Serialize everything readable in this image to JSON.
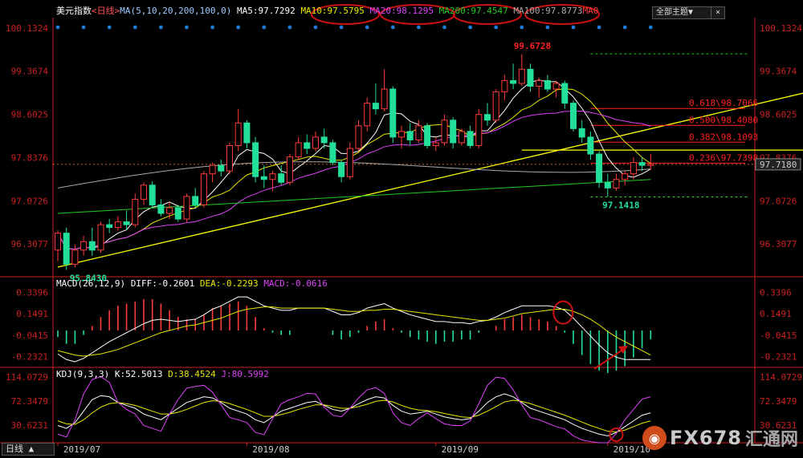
{
  "header": {
    "name": "美元指数",
    "period": "<日线>",
    "ma_label": "MA(5,10,20,200,100,0)",
    "ma5": "MA5:97.7292",
    "ma10": "MA10:97.5795",
    "ma20": "MA20:98.1295",
    "ma200": "MA200:97.4547",
    "ma100": "MA100:97.8773",
    "ma0": "MA0",
    "theme_button": "全部主题▼",
    "close_icon": "×"
  },
  "colors": {
    "up": "#ff3b3b",
    "down": "#22e09a",
    "ma5": "#ffffff",
    "ma10": "#e8e800",
    "ma20": "#e040fb",
    "ma200": "#22cc22",
    "ma100": "#aaaaaa",
    "trend": "#ffff00",
    "fib": "#ff2020",
    "axis": "#cc2020",
    "annot": "#cc1111"
  },
  "chart_data": [
    {
      "type": "candlestick",
      "title": "美元指数 <日线>",
      "ylim": [
        95.8,
        100.2
      ],
      "y_ticks": [
        "100.1324",
        "99.3674",
        "98.6025",
        "97.8376",
        "97.0726",
        "96.3077"
      ],
      "x_ticks": [
        {
          "label": "2019/07",
          "x": 0
        },
        {
          "label": "2019/08",
          "x": 22
        },
        {
          "label": "2019/09",
          "x": 44
        },
        {
          "label": "2019/10",
          "x": 64
        }
      ],
      "labels": {
        "high": "99.6728",
        "low": "95.8430",
        "low2": "97.1418",
        "last": "97.7180"
      },
      "fibonacci": [
        {
          "label": "0.618\\98.7066",
          "value": 98.7066
        },
        {
          "label": "0.500\\98.4080",
          "value": 98.408
        },
        {
          "label": "0.382\\98.1093",
          "value": 98.1093
        },
        {
          "label": "0.236\\97.7398",
          "value": 97.7398
        }
      ],
      "fib_dashed": [
        99.6728,
        97.1418
      ],
      "trendline": [
        [
          0,
          95.9
        ],
        [
          117,
          100.05
        ]
      ],
      "horizontal_line": {
        "value": 97.97,
        "x0": 54,
        "x1": 92
      },
      "dashed_last": 97.718,
      "candles": [
        {
          "o": 96.2,
          "h": 96.55,
          "l": 96.0,
          "c": 96.5
        },
        {
          "o": 96.5,
          "h": 96.6,
          "l": 95.85,
          "c": 95.95
        },
        {
          "o": 95.95,
          "h": 96.3,
          "l": 95.9,
          "c": 96.2
        },
        {
          "o": 96.2,
          "h": 96.45,
          "l": 96.1,
          "c": 96.35
        },
        {
          "o": 96.35,
          "h": 96.6,
          "l": 96.1,
          "c": 96.2
        },
        {
          "o": 96.2,
          "h": 96.7,
          "l": 96.15,
          "c": 96.65
        },
        {
          "o": 96.65,
          "h": 96.75,
          "l": 96.5,
          "c": 96.6
        },
        {
          "o": 96.6,
          "h": 96.8,
          "l": 96.55,
          "c": 96.7
        },
        {
          "o": 96.7,
          "h": 96.9,
          "l": 96.55,
          "c": 96.65
        },
        {
          "o": 96.65,
          "h": 97.2,
          "l": 96.6,
          "c": 97.1
        },
        {
          "o": 97.1,
          "h": 97.4,
          "l": 97.0,
          "c": 97.35
        },
        {
          "o": 97.35,
          "h": 97.42,
          "l": 96.95,
          "c": 97.0
        },
        {
          "o": 97.0,
          "h": 97.1,
          "l": 96.8,
          "c": 96.85
        },
        {
          "o": 96.85,
          "h": 97.05,
          "l": 96.75,
          "c": 96.95
        },
        {
          "o": 96.95,
          "h": 97.0,
          "l": 96.7,
          "c": 96.75
        },
        {
          "o": 96.75,
          "h": 97.2,
          "l": 96.7,
          "c": 97.15
        },
        {
          "o": 97.15,
          "h": 97.3,
          "l": 96.95,
          "c": 97.0
        },
        {
          "o": 97.0,
          "h": 97.6,
          "l": 96.95,
          "c": 97.55
        },
        {
          "o": 97.55,
          "h": 97.75,
          "l": 97.4,
          "c": 97.7
        },
        {
          "o": 97.7,
          "h": 97.8,
          "l": 97.5,
          "c": 97.6
        },
        {
          "o": 97.6,
          "h": 98.1,
          "l": 97.55,
          "c": 98.05
        },
        {
          "o": 98.05,
          "h": 98.7,
          "l": 97.95,
          "c": 98.45
        },
        {
          "o": 98.45,
          "h": 98.5,
          "l": 98.0,
          "c": 98.1
        },
        {
          "o": 98.1,
          "h": 98.2,
          "l": 97.4,
          "c": 97.5
        },
        {
          "o": 97.5,
          "h": 97.7,
          "l": 97.3,
          "c": 97.45
        },
        {
          "o": 97.45,
          "h": 97.6,
          "l": 97.25,
          "c": 97.55
        },
        {
          "o": 97.55,
          "h": 97.7,
          "l": 97.35,
          "c": 97.4
        },
        {
          "o": 97.4,
          "h": 97.9,
          "l": 97.35,
          "c": 97.85
        },
        {
          "o": 97.85,
          "h": 98.2,
          "l": 97.8,
          "c": 98.1
        },
        {
          "o": 98.1,
          "h": 98.25,
          "l": 97.9,
          "c": 98.0
        },
        {
          "o": 98.0,
          "h": 98.3,
          "l": 97.95,
          "c": 98.2
        },
        {
          "o": 98.2,
          "h": 98.35,
          "l": 98.0,
          "c": 98.1
        },
        {
          "o": 98.1,
          "h": 98.15,
          "l": 97.7,
          "c": 97.75
        },
        {
          "o": 97.75,
          "h": 97.8,
          "l": 97.4,
          "c": 97.5
        },
        {
          "o": 97.5,
          "h": 98.1,
          "l": 97.45,
          "c": 98.0
        },
        {
          "o": 98.0,
          "h": 98.5,
          "l": 97.95,
          "c": 98.4
        },
        {
          "o": 98.4,
          "h": 98.9,
          "l": 98.3,
          "c": 98.8
        },
        {
          "o": 98.8,
          "h": 99.15,
          "l": 98.6,
          "c": 98.7
        },
        {
          "o": 98.7,
          "h": 99.4,
          "l": 98.65,
          "c": 99.05
        },
        {
          "o": 99.05,
          "h": 99.1,
          "l": 98.1,
          "c": 98.2
        },
        {
          "o": 98.2,
          "h": 98.4,
          "l": 98.0,
          "c": 98.3
        },
        {
          "o": 98.3,
          "h": 98.45,
          "l": 98.05,
          "c": 98.15
        },
        {
          "o": 98.15,
          "h": 98.5,
          "l": 98.1,
          "c": 98.4
        },
        {
          "o": 98.4,
          "h": 98.45,
          "l": 98.0,
          "c": 98.05
        },
        {
          "o": 98.05,
          "h": 98.2,
          "l": 97.95,
          "c": 98.1
        },
        {
          "o": 98.1,
          "h": 98.6,
          "l": 98.05,
          "c": 98.5
        },
        {
          "o": 98.5,
          "h": 98.55,
          "l": 98.0,
          "c": 98.1
        },
        {
          "o": 98.1,
          "h": 98.35,
          "l": 98.05,
          "c": 98.3
        },
        {
          "o": 98.3,
          "h": 98.4,
          "l": 98.0,
          "c": 98.05
        },
        {
          "o": 98.05,
          "h": 98.7,
          "l": 98.0,
          "c": 98.6
        },
        {
          "o": 98.6,
          "h": 98.8,
          "l": 98.4,
          "c": 98.5
        },
        {
          "o": 98.5,
          "h": 99.05,
          "l": 98.45,
          "c": 99.0
        },
        {
          "o": 99.0,
          "h": 99.3,
          "l": 98.85,
          "c": 99.2
        },
        {
          "o": 99.2,
          "h": 99.5,
          "l": 99.05,
          "c": 99.15
        },
        {
          "o": 99.15,
          "h": 99.67,
          "l": 99.1,
          "c": 99.4
        },
        {
          "o": 99.4,
          "h": 99.5,
          "l": 99.0,
          "c": 99.1
        },
        {
          "o": 99.1,
          "h": 99.25,
          "l": 98.9,
          "c": 99.2
        },
        {
          "o": 99.2,
          "h": 99.3,
          "l": 99.0,
          "c": 99.05
        },
        {
          "o": 99.05,
          "h": 99.2,
          "l": 98.9,
          "c": 99.15
        },
        {
          "o": 99.15,
          "h": 99.2,
          "l": 98.7,
          "c": 98.8
        },
        {
          "o": 98.8,
          "h": 98.85,
          "l": 98.3,
          "c": 98.35
        },
        {
          "o": 98.35,
          "h": 98.5,
          "l": 98.1,
          "c": 98.2
        },
        {
          "o": 98.2,
          "h": 98.3,
          "l": 97.8,
          "c": 97.9
        },
        {
          "o": 97.9,
          "h": 97.95,
          "l": 97.3,
          "c": 97.4
        },
        {
          "o": 97.4,
          "h": 97.55,
          "l": 97.14,
          "c": 97.3
        },
        {
          "o": 97.3,
          "h": 97.55,
          "l": 97.25,
          "c": 97.45
        },
        {
          "o": 97.45,
          "h": 97.6,
          "l": 97.35,
          "c": 97.55
        },
        {
          "o": 97.55,
          "h": 97.85,
          "l": 97.45,
          "c": 97.75
        },
        {
          "o": 97.75,
          "h": 97.85,
          "l": 97.6,
          "c": 97.7
        },
        {
          "o": 97.7,
          "h": 97.9,
          "l": 97.62,
          "c": 97.72
        }
      ]
    },
    {
      "type": "bar",
      "title": "MACD(26,12,9)",
      "legend": [
        "DIFF:-0.2601",
        "DEA:-0.2293",
        "MACD:-0.0616"
      ],
      "ylim": [
        -0.33,
        0.43
      ],
      "y_ticks": [
        "0.3396",
        "0.1491",
        "-0.0415",
        "-0.2321"
      ],
      "diff": [
        -0.21,
        -0.26,
        -0.28,
        -0.25,
        -0.2,
        -0.15,
        -0.1,
        -0.06,
        -0.02,
        0.02,
        0.06,
        0.09,
        0.1,
        0.09,
        0.08,
        0.09,
        0.1,
        0.14,
        0.19,
        0.22,
        0.26,
        0.3,
        0.3,
        0.26,
        0.22,
        0.2,
        0.18,
        0.18,
        0.2,
        0.2,
        0.2,
        0.2,
        0.17,
        0.14,
        0.14,
        0.16,
        0.2,
        0.22,
        0.24,
        0.2,
        0.17,
        0.14,
        0.12,
        0.1,
        0.08,
        0.08,
        0.07,
        0.07,
        0.06,
        0.08,
        0.09,
        0.12,
        0.16,
        0.19,
        0.22,
        0.22,
        0.22,
        0.22,
        0.21,
        0.18,
        0.11,
        0.03,
        -0.05,
        -0.13,
        -0.2,
        -0.24,
        -0.26,
        -0.26,
        -0.26,
        -0.26
      ],
      "dea": [
        -0.18,
        -0.2,
        -0.22,
        -0.23,
        -0.22,
        -0.21,
        -0.19,
        -0.17,
        -0.14,
        -0.11,
        -0.08,
        -0.05,
        -0.02,
        0.0,
        0.02,
        0.04,
        0.05,
        0.07,
        0.09,
        0.11,
        0.14,
        0.17,
        0.19,
        0.2,
        0.21,
        0.21,
        0.2,
        0.2,
        0.2,
        0.2,
        0.2,
        0.2,
        0.19,
        0.18,
        0.17,
        0.17,
        0.18,
        0.18,
        0.19,
        0.19,
        0.18,
        0.17,
        0.16,
        0.15,
        0.14,
        0.13,
        0.12,
        0.11,
        0.1,
        0.09,
        0.09,
        0.1,
        0.11,
        0.13,
        0.15,
        0.16,
        0.17,
        0.18,
        0.19,
        0.19,
        0.17,
        0.14,
        0.1,
        0.05,
        -0.01,
        -0.06,
        -0.1,
        -0.14,
        -0.18,
        -0.22
      ],
      "macd": [
        -0.06,
        -0.12,
        -0.12,
        -0.04,
        0.04,
        0.12,
        0.18,
        0.22,
        0.24,
        0.26,
        0.28,
        0.28,
        0.24,
        0.18,
        0.12,
        0.1,
        0.1,
        0.14,
        0.2,
        0.22,
        0.24,
        0.26,
        0.22,
        0.12,
        0.02,
        -0.02,
        -0.04,
        -0.04,
        0.0,
        0.0,
        0.0,
        0.0,
        -0.04,
        -0.08,
        -0.06,
        -0.02,
        0.04,
        0.08,
        0.1,
        0.02,
        -0.02,
        -0.06,
        -0.08,
        -0.1,
        -0.12,
        -0.1,
        -0.1,
        -0.08,
        -0.08,
        -0.02,
        0.0,
        0.04,
        0.1,
        0.12,
        0.14,
        0.12,
        0.1,
        0.08,
        0.04,
        -0.02,
        -0.12,
        -0.22,
        -0.3,
        -0.36,
        -0.38,
        -0.36,
        -0.32,
        -0.24,
        -0.16,
        -0.08
      ]
    },
    {
      "type": "line",
      "title": "KDJ(9,3,3)",
      "legend": [
        "K:52.5013",
        "D:38.4524",
        "J:80.5992"
      ],
      "ylim": [
        0,
        120
      ],
      "y_ticks": [
        "114.0729",
        "72.3479",
        "30.6231"
      ],
      "k": [
        30,
        25,
        35,
        55,
        75,
        82,
        80,
        70,
        65,
        60,
        50,
        45,
        40,
        50,
        60,
        70,
        75,
        80,
        78,
        70,
        60,
        55,
        50,
        40,
        35,
        45,
        55,
        60,
        65,
        70,
        72,
        65,
        58,
        55,
        60,
        68,
        75,
        80,
        78,
        65,
        55,
        50,
        52,
        55,
        50,
        45,
        42,
        40,
        42,
        55,
        70,
        80,
        85,
        80,
        70,
        60,
        55,
        50,
        45,
        40,
        32,
        25,
        20,
        15,
        12,
        18,
        28,
        38,
        48,
        52
      ],
      "d": [
        38,
        33,
        32,
        40,
        52,
        62,
        68,
        70,
        68,
        65,
        60,
        55,
        50,
        50,
        53,
        58,
        64,
        70,
        73,
        72,
        68,
        63,
        58,
        52,
        46,
        46,
        49,
        53,
        58,
        62,
        66,
        66,
        63,
        60,
        60,
        63,
        67,
        72,
        74,
        71,
        65,
        60,
        57,
        56,
        54,
        51,
        48,
        45,
        44,
        48,
        55,
        63,
        71,
        74,
        72,
        68,
        63,
        58,
        53,
        48,
        42,
        36,
        30,
        25,
        20,
        19,
        22,
        28,
        34,
        38
      ],
      "j": [
        15,
        10,
        40,
        85,
        110,
        115,
        105,
        70,
        58,
        50,
        30,
        25,
        20,
        50,
        75,
        95,
        98,
        100,
        88,
        66,
        44,
        40,
        35,
        18,
        14,
        42,
        68,
        75,
        80,
        86,
        85,
        62,
        48,
        45,
        60,
        78,
        92,
        96,
        86,
        52,
        35,
        30,
        42,
        52,
        42,
        33,
        30,
        30,
        38,
        68,
        100,
        114,
        112,
        92,
        66,
        44,
        40,
        34,
        28,
        24,
        12,
        5,
        2,
        0,
        0,
        16,
        40,
        58,
        76,
        80
      ]
    }
  ],
  "footer": {
    "tab_label": "日线"
  },
  "watermark": {
    "text": "FX678",
    "cn": "汇通网",
    "logo_glyph": "◉"
  }
}
